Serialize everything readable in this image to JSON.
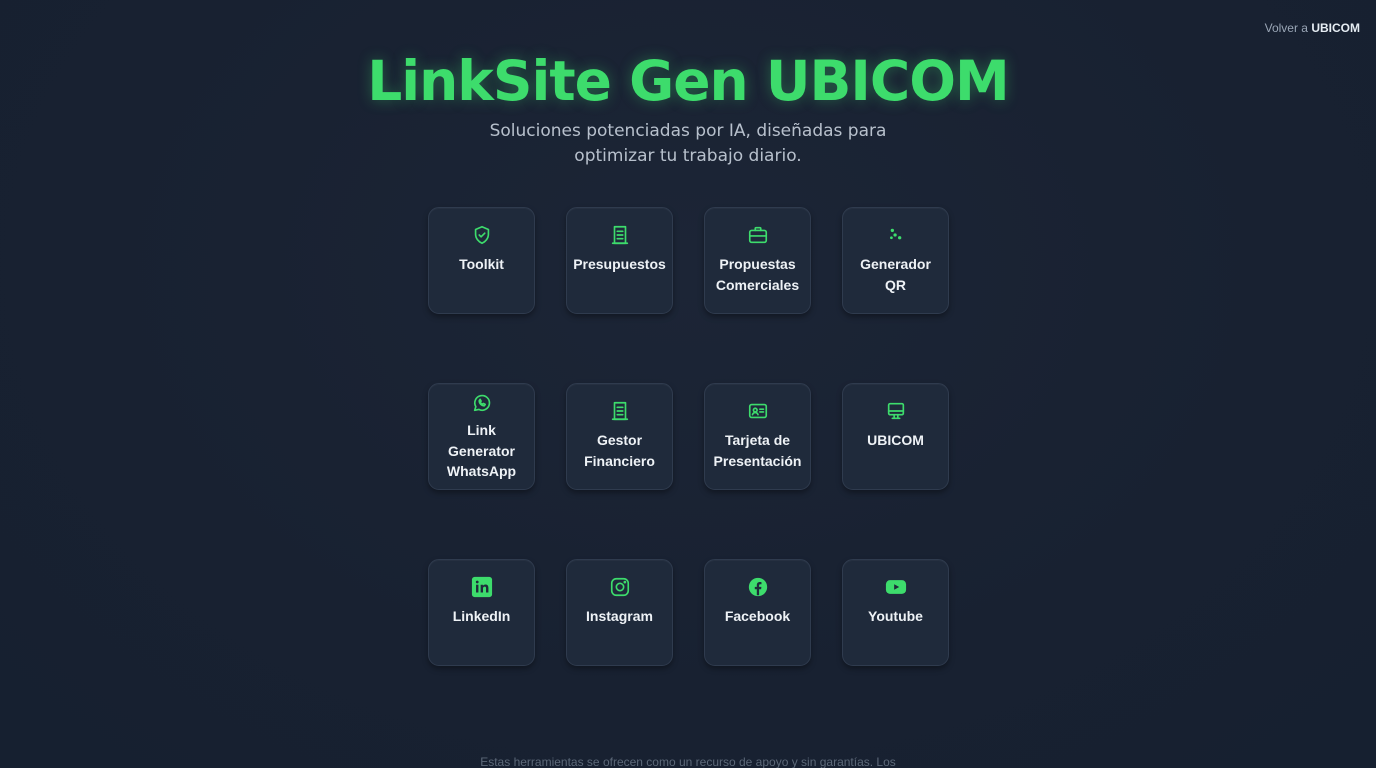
{
  "nav": {
    "back_prefix": "Volver a",
    "back_target": "UBICOM"
  },
  "hero": {
    "title": "LinkSite Gen UBICOM",
    "subtitle": "Soluciones potenciadas por IA, diseñadas para optimizar tu trabajo diario."
  },
  "colors": {
    "accent": "#3ddc6c",
    "background": "#182131",
    "card": "#1f2a3b"
  },
  "tools": [
    {
      "label": "Toolkit",
      "icon": "shield-check-icon"
    },
    {
      "label": "Presupuestos",
      "icon": "receipt-icon"
    },
    {
      "label": "Propuestas Comerciales",
      "icon": "briefcase-icon"
    },
    {
      "label": "Generador QR",
      "icon": "qr-dots-icon"
    },
    {
      "label": "Link Generator WhatsApp",
      "icon": "whatsapp-icon"
    },
    {
      "label": "Gestor Financiero",
      "icon": "receipt-icon"
    },
    {
      "label": "Tarjeta de Presentación",
      "icon": "id-card-icon"
    },
    {
      "label": "UBICOM",
      "icon": "monitor-icon"
    },
    {
      "label": "LinkedIn",
      "icon": "linkedin-icon"
    },
    {
      "label": "Instagram",
      "icon": "instagram-icon"
    },
    {
      "label": "Facebook",
      "icon": "facebook-icon"
    },
    {
      "label": "Youtube",
      "icon": "youtube-icon"
    }
  ],
  "footer": {
    "note": "Estas herramientas se ofrecen como un recurso de apoyo y sin garantías. Los"
  }
}
